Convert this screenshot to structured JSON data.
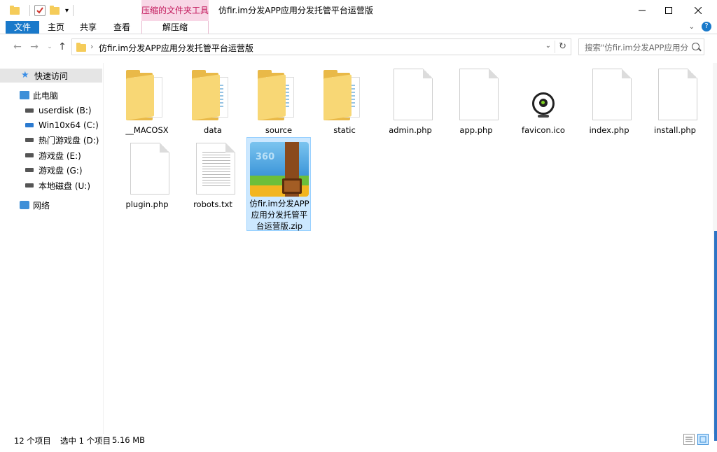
{
  "window": {
    "title": "仿fir.im分发APP应用分发托管平台运营版",
    "context_tab_group": "压缩的文件夹工具"
  },
  "ribbon": {
    "tabs": [
      "文件",
      "主页",
      "共享",
      "查看"
    ],
    "context_tab": "解压缩"
  },
  "address": {
    "path": "仿fir.im分发APP应用分发托管平台运营版",
    "crumb_separator": "›"
  },
  "search": {
    "placeholder": "搜索\"仿fir.im分发APP应用分..."
  },
  "sidebar": {
    "items": [
      {
        "label": "快速访问",
        "icon": "star-icon",
        "selected": true
      },
      {
        "label": "此电脑",
        "icon": "pc-icon"
      },
      {
        "label": "userdisk (B:)",
        "icon": "drive-icon"
      },
      {
        "label": "Win10x64 (C:)",
        "icon": "windows-drive-icon"
      },
      {
        "label": "热门游戏盘 (D:)",
        "icon": "drive-icon"
      },
      {
        "label": "游戏盘 (E:)",
        "icon": "drive-icon"
      },
      {
        "label": "游戏盘 (G:)",
        "icon": "drive-icon"
      },
      {
        "label": "本地磁盘 (U:)",
        "icon": "drive-icon"
      },
      {
        "label": "网络",
        "icon": "network-icon"
      }
    ]
  },
  "files": [
    {
      "name": "__MACOSX",
      "type": "folder"
    },
    {
      "name": "data",
      "type": "folder"
    },
    {
      "name": "source",
      "type": "folder"
    },
    {
      "name": "static",
      "type": "folder"
    },
    {
      "name": "admin.php",
      "type": "php"
    },
    {
      "name": "app.php",
      "type": "php"
    },
    {
      "name": "favicon.ico",
      "type": "ico"
    },
    {
      "name": "index.php",
      "type": "php"
    },
    {
      "name": "install.php",
      "type": "php"
    },
    {
      "name": "plugin.php",
      "type": "php"
    },
    {
      "name": "robots.txt",
      "type": "txt"
    },
    {
      "name": "仿fir.im分发APP应用分发托管平台运营版.zip",
      "type": "zip",
      "selected": true,
      "label_lines": [
        "仿fir.im分发APP",
        "应用分发托管平",
        "台运营版.zip"
      ]
    }
  ],
  "zip_icon_text": "360",
  "status": {
    "count": "12 个项目",
    "selection": "选中 1 个项目",
    "size": "5.16 MB"
  },
  "colors": {
    "accent": "#1979ca",
    "context_tab_bg": "#f8d7e6",
    "context_tab_text": "#c2185b",
    "selection_bg": "#cce8ff",
    "folder": "#f8d775"
  }
}
